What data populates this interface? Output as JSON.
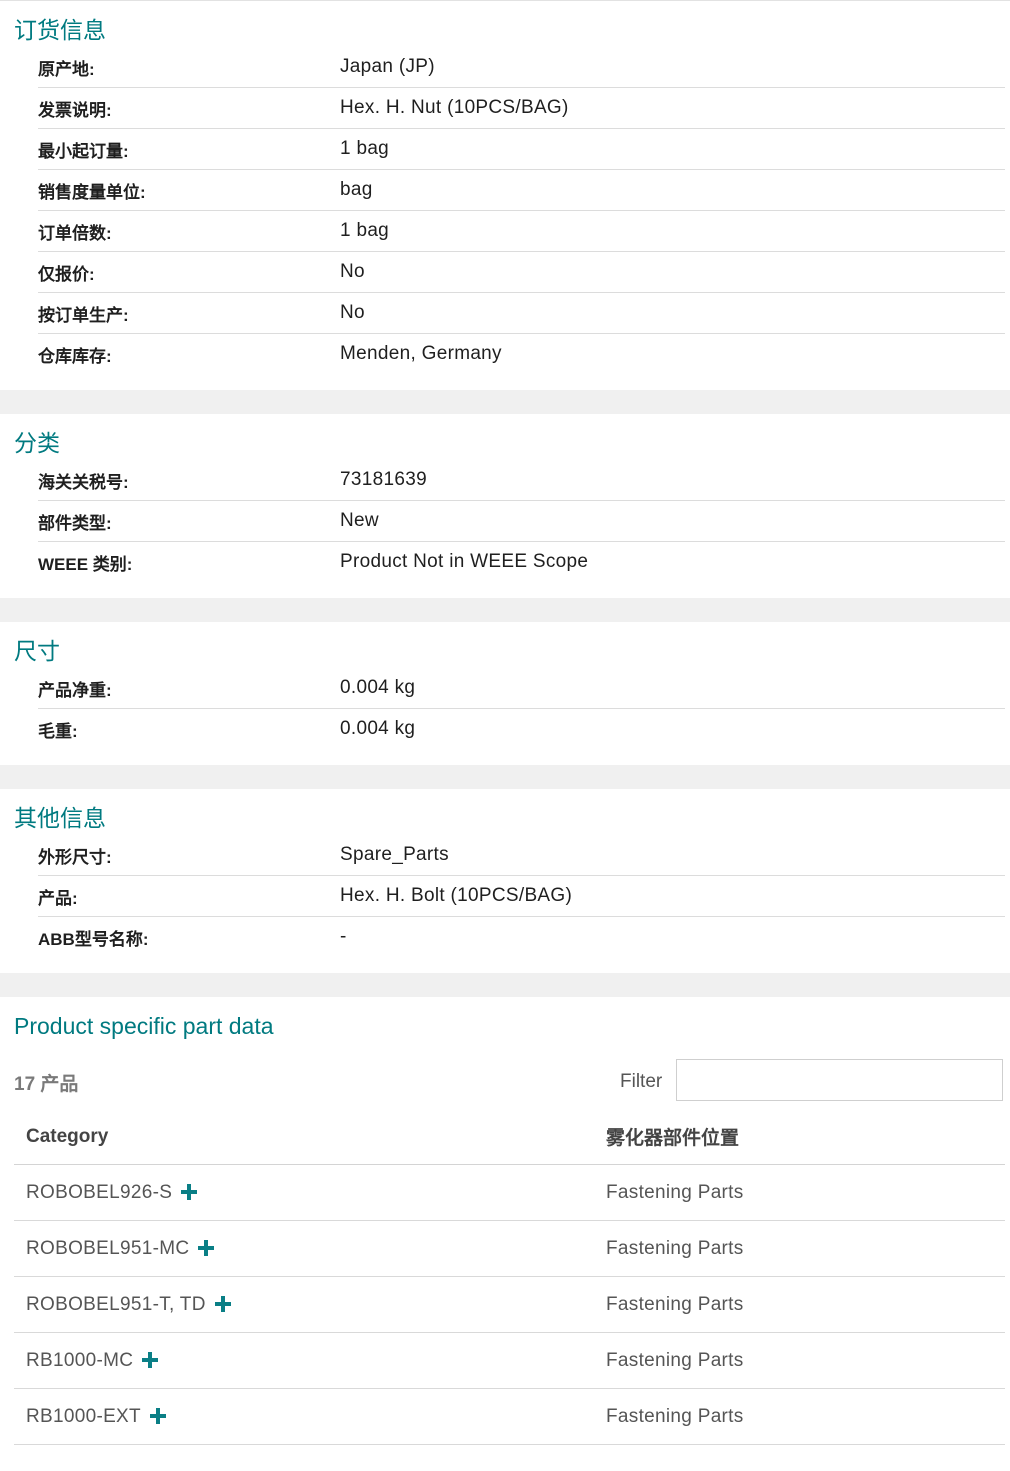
{
  "ordering": {
    "title": "订货信息",
    "rows": [
      {
        "label": "原产地:",
        "value": "Japan (JP)"
      },
      {
        "label": "发票说明:",
        "value": "Hex. H. Nut (10PCS/BAG)"
      },
      {
        "label": "最小起订量:",
        "value": "1 bag"
      },
      {
        "label": "销售度量单位:",
        "value": "bag"
      },
      {
        "label": "订单倍数:",
        "value": "1 bag"
      },
      {
        "label": "仅报价:",
        "value": "No"
      },
      {
        "label": "按订单生产:",
        "value": "No"
      },
      {
        "label": "仓库库存:",
        "value": "Menden, Germany"
      }
    ]
  },
  "classification": {
    "title": "分类",
    "rows": [
      {
        "label": "海关关税号:",
        "value": "73181639"
      },
      {
        "label": "部件类型:",
        "value": "New"
      },
      {
        "label": "WEEE 类别:",
        "value": "Product Not in WEEE Scope"
      }
    ]
  },
  "dimensions": {
    "title": "尺寸",
    "rows": [
      {
        "label": "产品净重:",
        "value": "0.004 kg"
      },
      {
        "label": "毛重:",
        "value": "0.004 kg"
      }
    ]
  },
  "other": {
    "title": "其他信息",
    "rows": [
      {
        "label": "外形尺寸:",
        "value": "Spare_Parts"
      },
      {
        "label": "产品:",
        "value": "Hex. H. Bolt (10PCS/BAG)"
      },
      {
        "label": "ABB型号名称:",
        "value": "-"
      }
    ]
  },
  "parts": {
    "title": "Product specific part data",
    "count_label": "17 产品",
    "filter_label": "Filter",
    "filter_value": "",
    "headers": {
      "category": "Category",
      "position": "雾化器部件位置"
    },
    "rows": [
      {
        "category": "ROBOBEL926-S",
        "position": "Fastening Parts"
      },
      {
        "category": "ROBOBEL951-MC",
        "position": "Fastening Parts"
      },
      {
        "category": "ROBOBEL951-T, TD",
        "position": "Fastening Parts"
      },
      {
        "category": "RB1000-MC",
        "position": "Fastening Parts"
      },
      {
        "category": "RB1000-EXT",
        "position": "Fastening Parts"
      }
    ]
  },
  "colors": {
    "accent": "#007a80",
    "plus_icon": "#0a7f86",
    "page_bg": "#f0f0f0"
  }
}
